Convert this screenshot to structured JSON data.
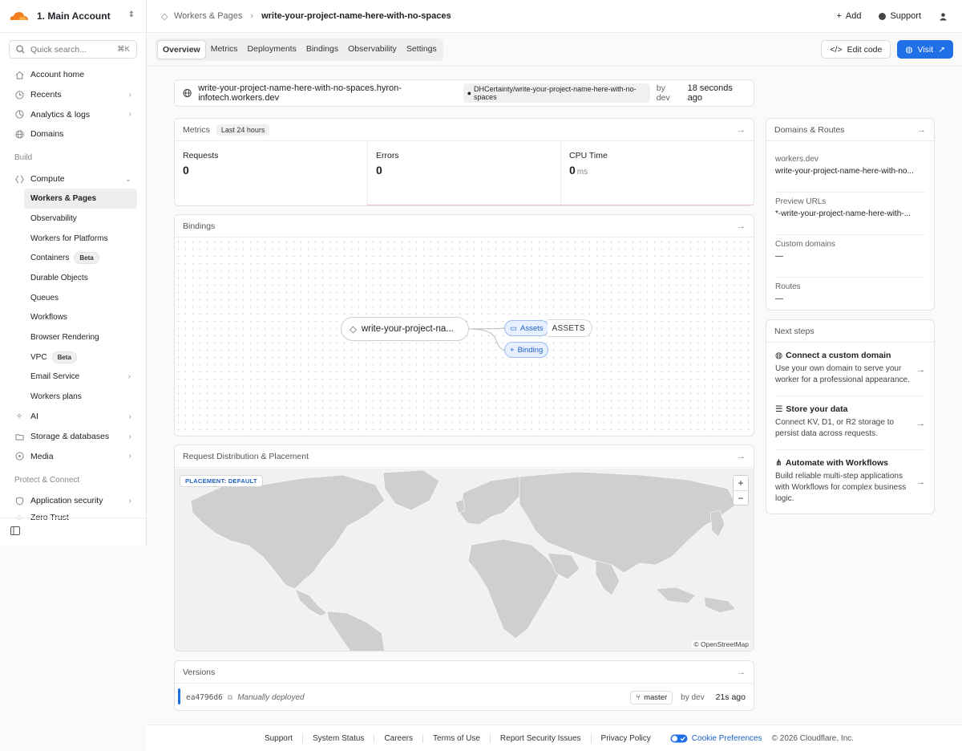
{
  "account": {
    "name": "1. Main Account"
  },
  "search": {
    "placeholder": "Quick search...",
    "shortcut": "⌘K"
  },
  "nav": {
    "top": [
      {
        "label": "Account home"
      },
      {
        "label": "Recents"
      },
      {
        "label": "Analytics & logs"
      },
      {
        "label": "Domains"
      }
    ],
    "build_section": "Build",
    "compute": "Compute",
    "compute_items": [
      {
        "label": "Workers & Pages"
      },
      {
        "label": "Observability"
      },
      {
        "label": "Workers for Platforms"
      },
      {
        "label": "Containers",
        "badge": "Beta"
      },
      {
        "label": "Durable Objects"
      },
      {
        "label": "Queues"
      },
      {
        "label": "Workflows"
      },
      {
        "label": "Browser Rendering"
      },
      {
        "label": "VPC",
        "badge": "Beta"
      },
      {
        "label": "Email Service"
      },
      {
        "label": "Workers plans"
      }
    ],
    "more": [
      {
        "label": "AI"
      },
      {
        "label": "Storage & databases"
      },
      {
        "label": "Media"
      }
    ],
    "protect_section": "Protect & Connect",
    "protect": [
      {
        "label": "Application security"
      },
      {
        "label": "Zero Trust"
      }
    ]
  },
  "header": {
    "crumb_parent": "Workers & Pages",
    "crumb_current": "write-your-project-name-here-with-no-spaces",
    "add": "Add",
    "support": "Support"
  },
  "tabs": [
    "Overview",
    "Metrics",
    "Deployments",
    "Bindings",
    "Observability",
    "Settings"
  ],
  "actions": {
    "edit_code": "Edit code",
    "visit": "Visit"
  },
  "urlbar": {
    "url": "write-your-project-name-here-with-no-spaces.hyron-infotech.workers.dev",
    "repo": "DHCertainty/write-your-project-name-here-with-no-spaces",
    "by": "by dev",
    "ago": "18 seconds ago"
  },
  "metrics": {
    "title": "Metrics",
    "range": "Last 24 hours",
    "items": [
      {
        "label": "Requests",
        "value": "0",
        "unit": ""
      },
      {
        "label": "Errors",
        "value": "0",
        "unit": ""
      },
      {
        "label": "CPU Time",
        "value": "0",
        "unit": "ms"
      }
    ]
  },
  "bindings": {
    "title": "Bindings",
    "worker": "write-your-project-na...",
    "assets_chip": "Assets",
    "assets_name": "ASSETS",
    "add_binding": "Binding"
  },
  "distribution": {
    "title": "Request Distribution & Placement",
    "placement": "PLACEMENT: DEFAULT",
    "zoom_in": "+",
    "zoom_out": "−",
    "attribution": "© OpenStreetMap"
  },
  "versions": {
    "title": "Versions",
    "hash": "ea4796d6",
    "deployed": "Manually deployed",
    "branch": "master",
    "by": "by dev",
    "ago": "21s ago"
  },
  "domains": {
    "title": "Domains & Routes",
    "items": [
      {
        "label": "workers.dev",
        "value": "write-your-project-name-here-with-no..."
      },
      {
        "label": "Preview URLs",
        "value": "*-write-your-project-name-here-with-..."
      },
      {
        "label": "Custom domains",
        "value": "—"
      },
      {
        "label": "Routes",
        "value": "—"
      }
    ]
  },
  "nextsteps": {
    "title": "Next steps",
    "items": [
      {
        "title": "Connect a custom domain",
        "desc": "Use your own domain to serve your worker for a professional appearance."
      },
      {
        "title": "Store your data",
        "desc": "Connect KV, D1, or R2 storage to persist data across requests."
      },
      {
        "title": "Automate with Workflows",
        "desc": "Build reliable multi-step applications with Workflows for complex business logic."
      }
    ]
  },
  "footer": {
    "links": [
      "Support",
      "System Status",
      "Careers",
      "Terms of Use",
      "Report Security Issues",
      "Privacy Policy"
    ],
    "cookie": "Cookie Preferences",
    "copyright": "© 2026 Cloudflare, Inc."
  },
  "colors": {
    "accent": "#1f6fe6",
    "brand": "#f38020"
  }
}
